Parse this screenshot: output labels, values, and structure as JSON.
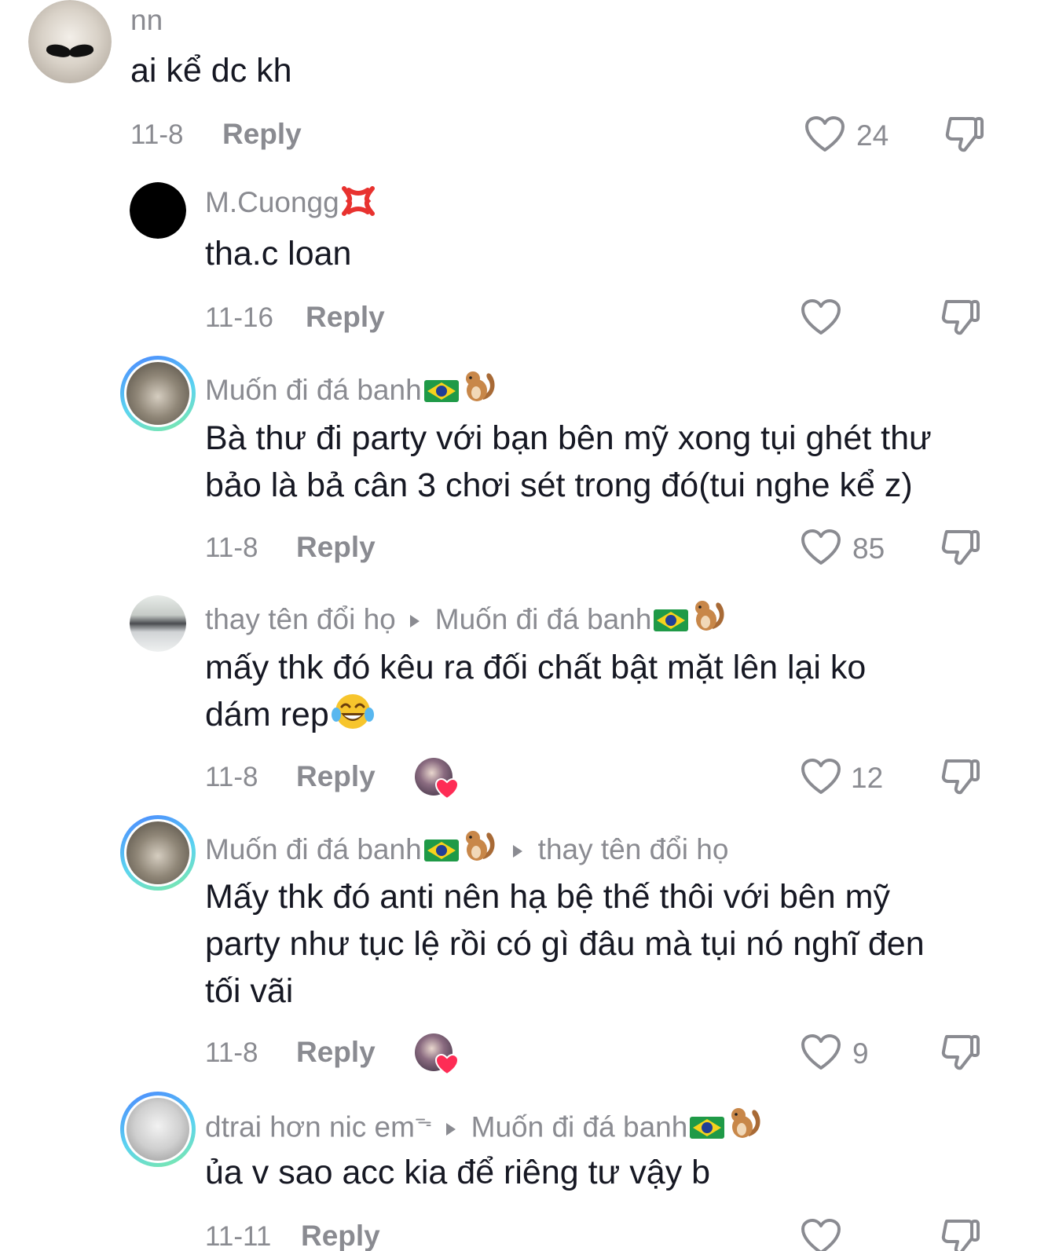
{
  "comments": [
    {
      "username": "nn",
      "text": "ai kể dc kh",
      "date": "11-8",
      "reply_label": "Reply",
      "likes": "24",
      "avatar": "cat-mustache-avatar"
    },
    {
      "username": "M.Cuongg",
      "username_emoji": "anger-symbol-emoji",
      "text": "tha.c loan",
      "date": "11-16",
      "reply_label": "Reply",
      "likes": "",
      "avatar": "black-avatar"
    },
    {
      "username": "Muốn đi đá banh",
      "username_emoji": [
        "brazil-flag-emoji",
        "chipmunk-emoji"
      ],
      "text_lines": [
        "Bà thư đi party với bạn bên mỹ xong tụi ghét thư",
        "bảo là bả cân 3 chơi sét trong đó(tui nghe kể z)"
      ],
      "date": "11-8",
      "reply_label": "Reply",
      "likes": "85",
      "avatar": "wolf-avatar"
    },
    {
      "username": "thay tên đổi họ",
      "reply_to": "Muốn đi đá banh",
      "reply_to_emoji": [
        "brazil-flag-emoji",
        "chipmunk-emoji"
      ],
      "text_lines": [
        "mấy thk đó kêu ra đối chất bật mặt lên lại ko",
        "dám rep"
      ],
      "text_emoji": "laughing-tears-emoji",
      "date": "11-8",
      "reply_label": "Reply",
      "likes": "12",
      "creator_liked": true,
      "avatar": "classroom-avatar"
    },
    {
      "username": "Muốn đi đá banh",
      "username_emoji": [
        "brazil-flag-emoji",
        "chipmunk-emoji"
      ],
      "reply_to": "thay tên đổi họ",
      "text_lines": [
        "Mấy thk đó anti nên hạ bệ thế thôi với bên mỹ",
        "party như tục lệ rồi có gì đâu mà tụi nó nghĩ đen",
        "tối vãi"
      ],
      "date": "11-8",
      "reply_label": "Reply",
      "likes": "9",
      "creator_liked": true,
      "avatar": "wolf-avatar"
    },
    {
      "username": "dtrai hơn nic em",
      "username_suffix": "ᯓ",
      "reply_to": "Muốn đi đá banh",
      "reply_to_emoji": [
        "brazil-flag-emoji",
        "chipmunk-emoji"
      ],
      "text": "ủa v sao acc kia để riêng tư vậy b",
      "date": "11-11",
      "reply_label": "Reply",
      "avatar": "mirror-selfie-avatar"
    }
  ],
  "colors": {
    "text": "#161823",
    "muted": "#8a8b91",
    "story_ring_start": "#4b86ff",
    "story_ring_end": "#7eeaa4",
    "heart_red": "#fe2c55"
  }
}
